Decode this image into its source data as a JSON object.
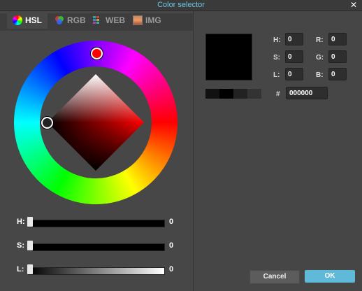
{
  "window": {
    "title": "Color selector",
    "close_symbol": "✕"
  },
  "tabs": [
    {
      "label": "HSL",
      "icon": "hsl-wheel-icon"
    },
    {
      "label": "RGB",
      "icon": "rgb-circles-icon"
    },
    {
      "label": "WEB",
      "icon": "web-grid-icon"
    },
    {
      "label": "IMG",
      "icon": "image-icon"
    }
  ],
  "active_tab": "HSL",
  "sliders": {
    "h": {
      "label": "H:",
      "value": "0"
    },
    "s": {
      "label": "S:",
      "value": "0"
    },
    "l": {
      "label": "L:",
      "value": "0"
    }
  },
  "fields": {
    "h": {
      "label": "H:",
      "value": "0"
    },
    "s": {
      "label": "S:",
      "value": "0"
    },
    "l": {
      "label": "L:",
      "value": "0"
    },
    "r": {
      "label": "R:",
      "value": "0"
    },
    "g": {
      "label": "G:",
      "value": "0"
    },
    "b": {
      "label": "B:",
      "value": "0"
    }
  },
  "hex": {
    "label": "#",
    "value": "000000"
  },
  "current_color": "#000000",
  "buttons": {
    "cancel": "Cancel",
    "ok": "OK"
  }
}
